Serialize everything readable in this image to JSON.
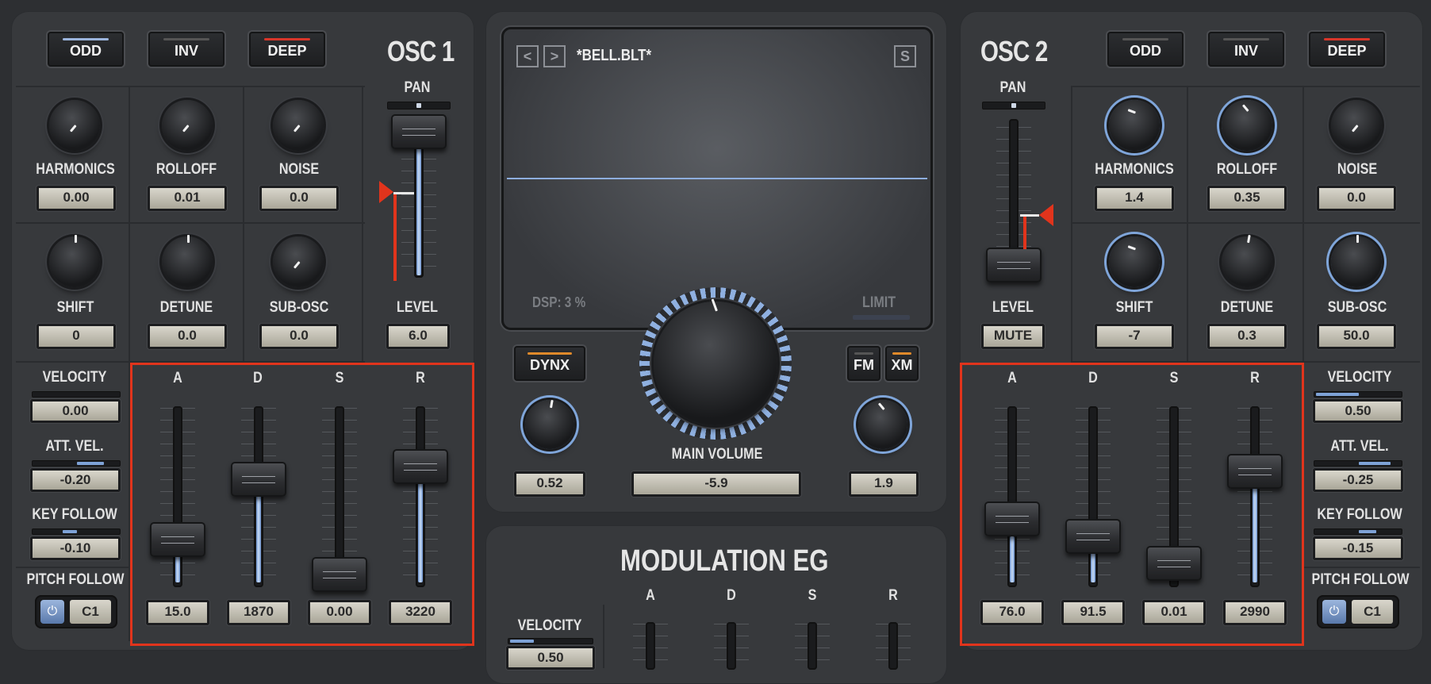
{
  "osc1": {
    "title": "OSC 1",
    "buttons": {
      "odd": "ODD",
      "inv": "INV",
      "deep": "DEEP"
    },
    "knobs": [
      {
        "label": "HARMONICS",
        "value": "0.00"
      },
      {
        "label": "ROLLOFF",
        "value": "0.01"
      },
      {
        "label": "NOISE",
        "value": "0.0"
      },
      {
        "label": "SHIFT",
        "value": "0"
      },
      {
        "label": "DETUNE",
        "value": "0.0"
      },
      {
        "label": "SUB-OSC",
        "value": "0.0"
      }
    ],
    "pan_label": "PAN",
    "level_label": "LEVEL",
    "level_value": "6.0",
    "velocity": {
      "label": "VELOCITY",
      "value": "0.00"
    },
    "att_vel": {
      "label": "ATT. VEL.",
      "value": "-0.20"
    },
    "key_follow": {
      "label": "KEY FOLLOW",
      "value": "-0.10"
    },
    "pitch_follow": {
      "label": "PITCH FOLLOW",
      "note": "C1"
    },
    "adsr": {
      "labels": [
        "A",
        "D",
        "S",
        "R"
      ],
      "values": [
        "15.0",
        "1870",
        "0.00",
        "3220"
      ]
    }
  },
  "osc2": {
    "title": "OSC 2",
    "buttons": {
      "odd": "ODD",
      "inv": "INV",
      "deep": "DEEP"
    },
    "knobs": [
      {
        "label": "HARMONICS",
        "value": "1.4"
      },
      {
        "label": "ROLLOFF",
        "value": "0.35"
      },
      {
        "label": "NOISE",
        "value": "0.0"
      },
      {
        "label": "SHIFT",
        "value": "-7"
      },
      {
        "label": "DETUNE",
        "value": "0.3"
      },
      {
        "label": "SUB-OSC",
        "value": "50.0"
      }
    ],
    "pan_label": "PAN",
    "level_label": "LEVEL",
    "level_value": "MUTE",
    "velocity": {
      "label": "VELOCITY",
      "value": "0.50"
    },
    "att_vel": {
      "label": "ATT. VEL.",
      "value": "-0.25"
    },
    "key_follow": {
      "label": "KEY FOLLOW",
      "value": "-0.15"
    },
    "pitch_follow": {
      "label": "PITCH FOLLOW",
      "note": "C1"
    },
    "adsr": {
      "labels": [
        "A",
        "D",
        "S",
        "R"
      ],
      "values": [
        "76.0",
        "91.5",
        "0.01",
        "2990"
      ]
    }
  },
  "center": {
    "prev": "<",
    "next": ">",
    "preset_name": "*BELL.BLT*",
    "s_button": "S",
    "dsp": "DSP: 3 %",
    "limit": "LIMIT",
    "dynx": "DYNX",
    "fm": "FM",
    "xm": "XM",
    "left_knob_value": "0.52",
    "main_volume_label": "MAIN VOLUME",
    "main_volume_value": "-5.9",
    "right_knob_value": "1.9"
  },
  "mod_eg": {
    "title": "MODULATION EG",
    "velocity_label": "VELOCITY",
    "velocity_value": "0.50",
    "labels": [
      "A",
      "D",
      "S",
      "R"
    ]
  },
  "colors": {
    "accent_blue": "#7ea2d6",
    "highlight_red": "#e1341c",
    "led_orange": "#e08a2a",
    "led_red": "#d9362a"
  }
}
